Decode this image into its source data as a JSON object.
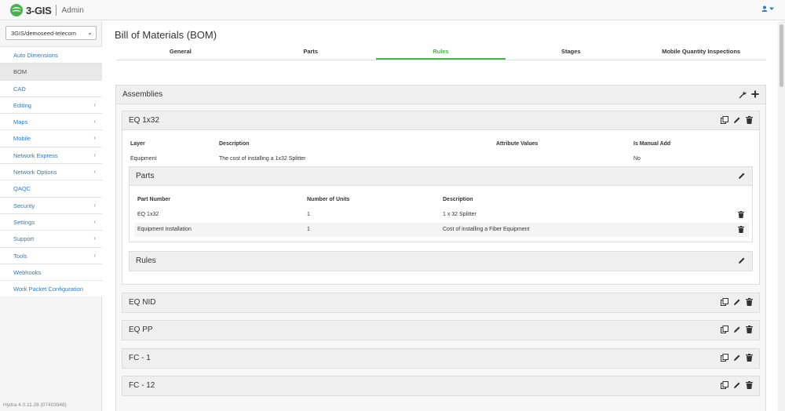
{
  "app": {
    "brand": "3-GIS",
    "section": "Admin"
  },
  "org_select": {
    "value": "3GIS/demoseed-telecom"
  },
  "sidebar": {
    "items": [
      {
        "label": "Auto Dimensions",
        "caret": false,
        "active": false
      },
      {
        "label": "BOM",
        "caret": false,
        "active": true
      },
      {
        "label": "CAD",
        "caret": false,
        "active": false
      },
      {
        "label": "Editing",
        "caret": true,
        "active": false
      },
      {
        "label": "Maps",
        "caret": true,
        "active": false
      },
      {
        "label": "Mobile",
        "caret": true,
        "active": false
      },
      {
        "label": "Network Express",
        "caret": true,
        "active": false
      },
      {
        "label": "Network Options",
        "caret": true,
        "active": false
      },
      {
        "label": "QAQC",
        "caret": false,
        "active": false
      },
      {
        "label": "Security",
        "caret": true,
        "active": false
      },
      {
        "label": "Settings",
        "caret": true,
        "active": false
      },
      {
        "label": "Support",
        "caret": true,
        "active": false
      },
      {
        "label": "Tools",
        "caret": true,
        "active": false
      },
      {
        "label": "Webhooks",
        "caret": false,
        "active": false
      },
      {
        "label": "Work Packet Configuration",
        "caret": false,
        "active": false
      }
    ],
    "version": "Hydra 4.0.11.28 (07403948)"
  },
  "page": {
    "title": "Bill of Materials (BOM)"
  },
  "tabs": [
    "General",
    "Parts",
    "Rules",
    "Stages",
    "Mobile Quantity Inspections"
  ],
  "active_tab": "Rules",
  "assemblies": {
    "title": "Assemblies",
    "expanded": {
      "title": "EQ 1x32",
      "headers": [
        "Layer",
        "Description",
        "Attribute Values",
        "Is Manual Add"
      ],
      "row": [
        "Equipment",
        "The cost of installing a 1x32 Splitter",
        "",
        "No"
      ],
      "parts": {
        "title": "Parts",
        "headers": [
          "Part Number",
          "Number of Units",
          "Description"
        ],
        "rows": [
          [
            "EQ 1x32",
            "1",
            "1 x 32 Splitter"
          ],
          [
            "Equipment Installation",
            "1",
            "Cost of installing a Fiber Equipment"
          ]
        ]
      },
      "rules": {
        "title": "Rules"
      }
    },
    "collapsed": [
      "EQ NID",
      "EQ PP",
      "FC - 1",
      "FC - 12"
    ]
  },
  "colors": {
    "accent": "#4caf50",
    "link": "#337ab7"
  }
}
